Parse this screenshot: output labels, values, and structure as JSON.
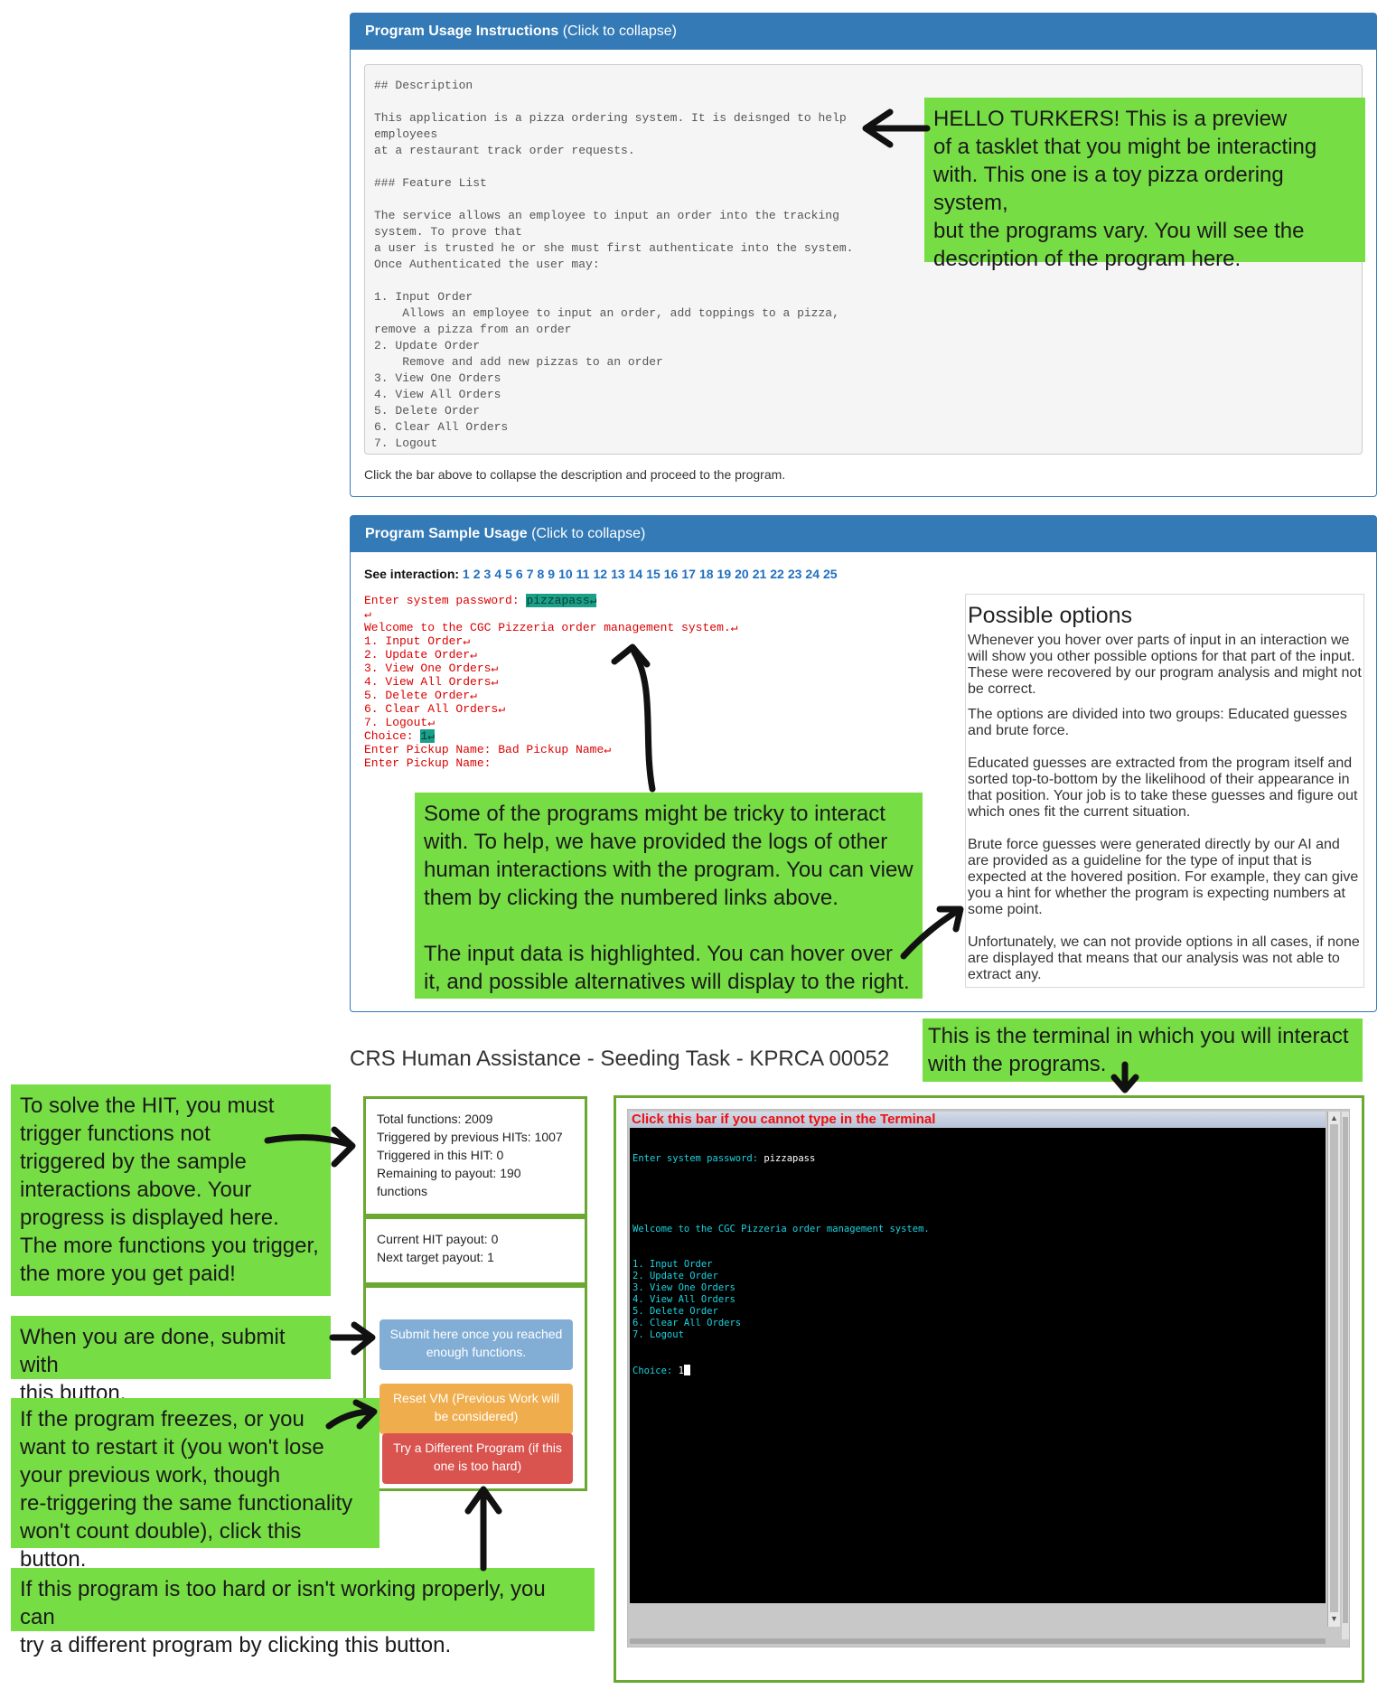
{
  "instructions_panel": {
    "header_bold": "Program Usage Instructions",
    "header_rest": " (Click to collapse)",
    "description": "## Description\n\nThis application is a pizza ordering system. It is deisnged to help\nemployees\nat a restaurant track order requests.\n\n### Feature List\n\nThe service allows an employee to input an order into the tracking\nsystem. To prove that\na user is trusted he or she must first authenticate into the system.\nOnce Authenticated the user may:\n\n1. Input Order\n    Allows an employee to input an order, add toppings to a pizza,\nremove a pizza from an order\n2. Update Order\n    Remove and add new pizzas to an order\n3. View One Orders\n4. View All Orders\n5. Delete Order\n6. Clear All Orders\n7. Logout",
    "footer": "Click the bar above to collapse the description and proceed to the program."
  },
  "sample_panel": {
    "header_bold": "Program Sample Usage",
    "header_rest": " (Click to collapse)",
    "see_label": "See interaction: ",
    "links": [
      "1",
      "2",
      "3",
      "4",
      "5",
      "6",
      "7",
      "8",
      "9",
      "10",
      "11",
      "12",
      "13",
      "14",
      "15",
      "16",
      "17",
      "18",
      "19",
      "20",
      "21",
      "22",
      "23",
      "24",
      "25"
    ],
    "log": {
      "prompt_password": "Enter system password: ",
      "password_input": "pizzapass↵",
      "blank": "↵",
      "welcome": "Welcome to the CGC Pizzeria order management system.↵",
      "menu": [
        "1. Input Order↵",
        "2. Update Order↵",
        "3. View One Orders↵",
        "4. View All Orders↵",
        "5. Delete Order↵",
        "6. Clear All Orders↵",
        "7. Logout↵"
      ],
      "choice_prompt": "Choice: ",
      "choice_input": "1↵",
      "pickup1": "Enter Pickup Name: Bad Pickup Name↵",
      "pickup2": "Enter Pickup Name:"
    },
    "options": {
      "title": "Possible options",
      "p1": "Whenever you hover over parts of input in an interaction we will show you other possible options for that part of the input. These were recovered by our program analysis and might not be correct.",
      "p2": "The options are divided into two groups: Educated guesses and brute force.",
      "p3": "Educated guesses are extracted from the program itself and sorted top-to-bottom by the likelihood of their appearance in that position. Your job is to take these guesses and figure out which ones fit the current situation.",
      "p4": "Brute force guesses were generated directly by our AI and are provided as a guideline for the type of input that is expected at the hovered position. For example, they can give you a hint for whether the program is expecting numbers at some point.",
      "p5": "Unfortunately, we can not provide options in all cases, if none are displayed that means that our analysis was not able to extract any."
    }
  },
  "task_title": "CRS Human Assistance - Seeding Task - KPRCA 00052",
  "stats": {
    "total": "Total functions: 2009",
    "previous": "Triggered by previous HITs: 1007",
    "this_hit": "Triggered in this HIT: 0",
    "remaining": "Remaining to payout: 190 functions",
    "current_payout": "Current HIT payout: 0",
    "next_payout": "Next target payout: 1"
  },
  "buttons": {
    "submit": "Submit here once you reached enough functions.",
    "reset": "Reset VM (Previous Work will be considered)",
    "different": "Try a Different Program (if this one is too hard)"
  },
  "terminal": {
    "bar_text": "Click this bar if you cannot type in the Terminal",
    "prompt": "Enter system password: ",
    "password": "pizzapass",
    "welcome": "Welcome to the CGC Pizzeria order management system.",
    "menu": [
      "1. Input Order",
      "2. Update Order",
      "3. View One Orders",
      "4. View All Orders",
      "5. Delete Order",
      "6. Clear All Orders",
      "7. Logout"
    ],
    "choice_prompt": "Choice: ",
    "choice_input": "1"
  },
  "notes": {
    "turkers": "HELLO TURKERS! This is a preview\nof a tasklet that you might be interacting\nwith. This one is a toy pizza ordering system,\nbut the programs vary. You will see the\ndescription of the program here.",
    "tricky": "Some of the programs might be tricky to interact\nwith. To help, we have provided the logs of other\nhuman interactions with the program. You can view\nthem by clicking the numbered links above.\n\nThe input data is highlighted. You can hover over\nit, and possible alternatives will display to the right.",
    "terminal": "This is the terminal in which you will interact\nwith the programs.",
    "solve": "To solve the HIT, you must\ntrigger functions not\ntriggered by the sample\ninteractions above. Your\nprogress is displayed here.\nThe more functions you trigger,\nthe more you get paid!",
    "submit": "When you are done, submit with\nthis button.",
    "freeze": "If the program freezes, or you\nwant to restart it (you won't lose\nyour previous work, though\nre-triggering the same functionality\nwon't count double), click this button.",
    "hard": "If this program is too hard or isn't working properly, you can\ntry a different program by clicking this button."
  },
  "colors": {
    "panel_blue": "#337ab7",
    "note_green": "#77dd44",
    "border_green": "#6aa832",
    "submit_blue": "#82aed6",
    "reset_orange": "#f0ad4e",
    "different_red": "#d9534f",
    "terminal_cyan": "#19d3e0",
    "log_red": "#dd0000"
  }
}
